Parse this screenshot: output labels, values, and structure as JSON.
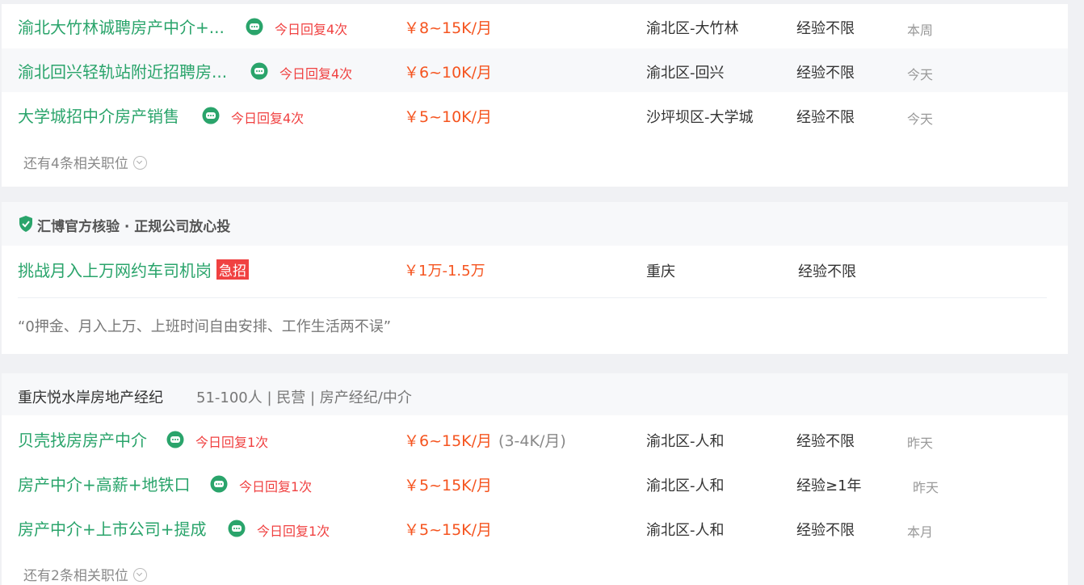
{
  "card1": {
    "jobs": [
      {
        "title": "渝北大竹林诚聘房产中介+...",
        "reply": "今日回复4次",
        "salary": "￥8~15K/月",
        "location": "渝北区-大竹林",
        "experience": "经验不限",
        "date": "本周"
      },
      {
        "title": "渝北回兴轻轨站附近招聘房...",
        "reply": "今日回复4次",
        "salary": "￥6~10K/月",
        "location": "渝北区-回兴",
        "experience": "经验不限",
        "date": "今天"
      },
      {
        "title": "大学城招中介房产销售",
        "reply": "今日回复4次",
        "salary": "￥5~10K/月",
        "location": "沙坪坝区-大学城",
        "experience": "经验不限",
        "date": "今天"
      }
    ],
    "more": "还有4条相关职位"
  },
  "card2": {
    "verify": "汇博官方核验 · 正规公司放心投",
    "title": "挑战月入上万网约车司机岗",
    "urgent": "急招",
    "salary": "￥1万-1.5万",
    "location": "重庆",
    "experience": "经验不限",
    "desc": "“0押金、月入上万、上班时间自由安排、工作生活两不误”"
  },
  "card3": {
    "company": "重庆悦水岸房地产经纪",
    "info": "51-100人 | 民营 | 房产经纪/中介",
    "jobs": [
      {
        "title": "贝壳找房房产中介",
        "reply": "今日回复1次",
        "salary": "￥6~15K/月",
        "salary_extra": "(3-4K/月)",
        "location": "渝北区-人和",
        "experience": "经验不限",
        "date": "昨天"
      },
      {
        "title": "房产中介+高薪+地铁口",
        "reply": "今日回复1次",
        "salary": "￥5~15K/月",
        "location": "渝北区-人和",
        "experience": "经验≥1年",
        "date": "昨天"
      },
      {
        "title": "房产中介+上市公司+提成",
        "reply": "今日回复1次",
        "salary": "￥5~15K/月",
        "location": "渝北区-人和",
        "experience": "经验不限",
        "date": "本月"
      }
    ],
    "more": "还有2条相关职位"
  },
  "colors": {
    "title_green": "#2aa46b",
    "salary_orange": "#f5541f",
    "reply_red": "#f04141",
    "urgent_red": "#f04141"
  },
  "icons": {
    "chat": "chat-bubble-icon",
    "verify": "shield-check-icon",
    "more": "circle-down-icon"
  }
}
